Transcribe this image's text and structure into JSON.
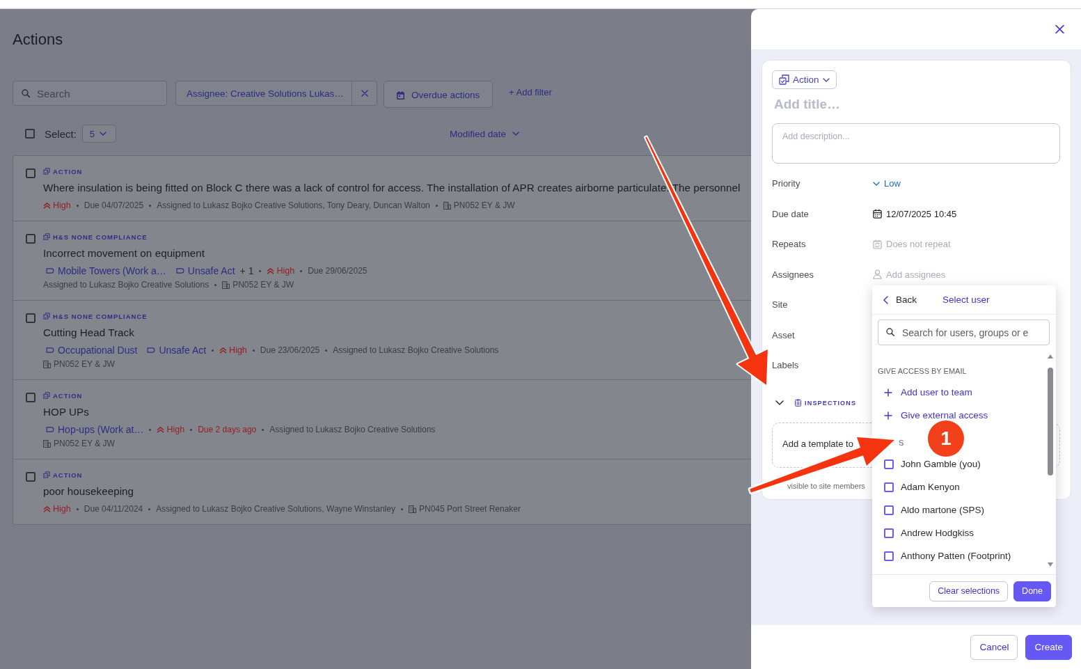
{
  "page": {
    "title": "Actions",
    "search": {
      "placeholder": "Search"
    },
    "filters": [
      {
        "kind": "chip",
        "label": "Assignee: Creative Solutions Lukas…"
      },
      {
        "kind": "button",
        "label": "Overdue actions"
      }
    ],
    "add_filter": "+ Add filter",
    "select": {
      "label": "Select:",
      "value": "5",
      "checked": false
    },
    "sort": "Modified date",
    "rows": [
      {
        "checked": false,
        "type": "ACTION",
        "title": "Where insulation is being fitted on Block C there was a lack of control for access. The installation of APR creates airborne particulate. The personnel",
        "lines": [
          [
            {
              "kind": "priority",
              "text": "High"
            },
            {
              "kind": "due",
              "text": "Due 04/07/2025",
              "overdue": false
            },
            {
              "kind": "assigned",
              "text": "Assigned to Lukasz Bojko Creative Solutions, Tony Deary, Duncan Walton"
            },
            {
              "kind": "site",
              "text": "PN052 EY & JW"
            }
          ]
        ]
      },
      {
        "checked": false,
        "type": "H&S NONE COMPLIANCE",
        "title": "Incorrect movement on equipment",
        "lines": [
          [
            {
              "kind": "tag",
              "text": "Mobile Towers (Work a…"
            },
            {
              "kind": "tag",
              "text": "Unsafe Act"
            },
            {
              "kind": "more",
              "text": "+ 1"
            },
            {
              "kind": "priority",
              "text": "High"
            },
            {
              "kind": "due",
              "text": "Due 29/06/2025",
              "overdue": false
            }
          ],
          [
            {
              "kind": "assigned",
              "text": "Assigned to Lukasz Bojko Creative Solutions"
            },
            {
              "kind": "site",
              "text": "PN052 EY & JW"
            }
          ]
        ]
      },
      {
        "checked": false,
        "type": "H&S NONE COMPLIANCE",
        "title": "Cutting Head Track",
        "lines": [
          [
            {
              "kind": "tag",
              "text": "Occupational Dust"
            },
            {
              "kind": "tag",
              "text": "Unsafe Act"
            },
            {
              "kind": "priority",
              "text": "High"
            },
            {
              "kind": "due",
              "text": "Due 23/06/2025",
              "overdue": false
            },
            {
              "kind": "assigned",
              "text": "Assigned to Lukasz Bojko Creative Solutions"
            }
          ],
          [
            {
              "kind": "site",
              "text": "PN052 EY & JW"
            }
          ]
        ]
      },
      {
        "checked": false,
        "type": "ACTION",
        "title": "HOP UPs",
        "lines": [
          [
            {
              "kind": "tag",
              "text": "Hop-ups (Work at…"
            },
            {
              "kind": "priority",
              "text": "High"
            },
            {
              "kind": "due",
              "text": "Due 2 days ago",
              "overdue": true
            },
            {
              "kind": "assigned",
              "text": "Assigned to Lukasz Bojko Creative Solutions"
            }
          ],
          [
            {
              "kind": "site",
              "text": "PN052 EY & JW"
            }
          ]
        ]
      },
      {
        "checked": false,
        "type": "ACTION",
        "title": "poor housekeeping",
        "lines": [
          [
            {
              "kind": "priority",
              "text": "High"
            },
            {
              "kind": "due",
              "text": "Due 04/11/2024",
              "overdue": false
            },
            {
              "kind": "assigned",
              "text": "Assigned to Lukasz Bojko Creative Solutions, Wayne Winstanley"
            },
            {
              "kind": "site",
              "text": "PN045 Port Street Renaker"
            }
          ]
        ]
      }
    ]
  },
  "drawer": {
    "type_button": "Action",
    "title_placeholder": "Add title…",
    "description_placeholder": "Add description...",
    "fields": [
      {
        "label": "Priority",
        "kind": "select",
        "value": "Low"
      },
      {
        "label": "Due date",
        "kind": "date",
        "value": "12/07/2025 10:45"
      },
      {
        "label": "Repeats",
        "kind": "repeat",
        "value": "Does not repeat"
      },
      {
        "label": "Assignees",
        "kind": "people",
        "value": "Add assignees"
      },
      {
        "label": "Site"
      },
      {
        "label": "Asset"
      },
      {
        "label": "Labels"
      }
    ],
    "section": {
      "label": "INSPECTIONS",
      "expanded": true
    },
    "template_prompt": "Add a template to",
    "visibility_note": "visible to site members",
    "user_picker": {
      "back": "Back",
      "title": "Select user",
      "search_placeholder": "Search for users, groups or e",
      "email_heading": "GIVE ACCESS BY EMAIL",
      "actions": [
        "Add user to team",
        "Give external access"
      ],
      "list_heading": "S",
      "users": [
        {
          "name": "John Gamble (you)",
          "checked": false
        },
        {
          "name": "Adam Kenyon",
          "checked": false
        },
        {
          "name": "Aldo martone (SPS)",
          "checked": false
        },
        {
          "name": "Andrew Hodgkiss",
          "checked": false
        },
        {
          "name": "Anthony Patten (Footprint)",
          "checked": false
        }
      ],
      "buttons": [
        {
          "label": "Clear selections",
          "kind": "secondary"
        },
        {
          "label": "Done",
          "kind": "primary"
        }
      ]
    },
    "buttons": [
      {
        "label": "Cancel",
        "kind": "secondary"
      },
      {
        "label": "Create",
        "kind": "primary"
      }
    ]
  },
  "annotation": {
    "step_number": "1"
  }
}
